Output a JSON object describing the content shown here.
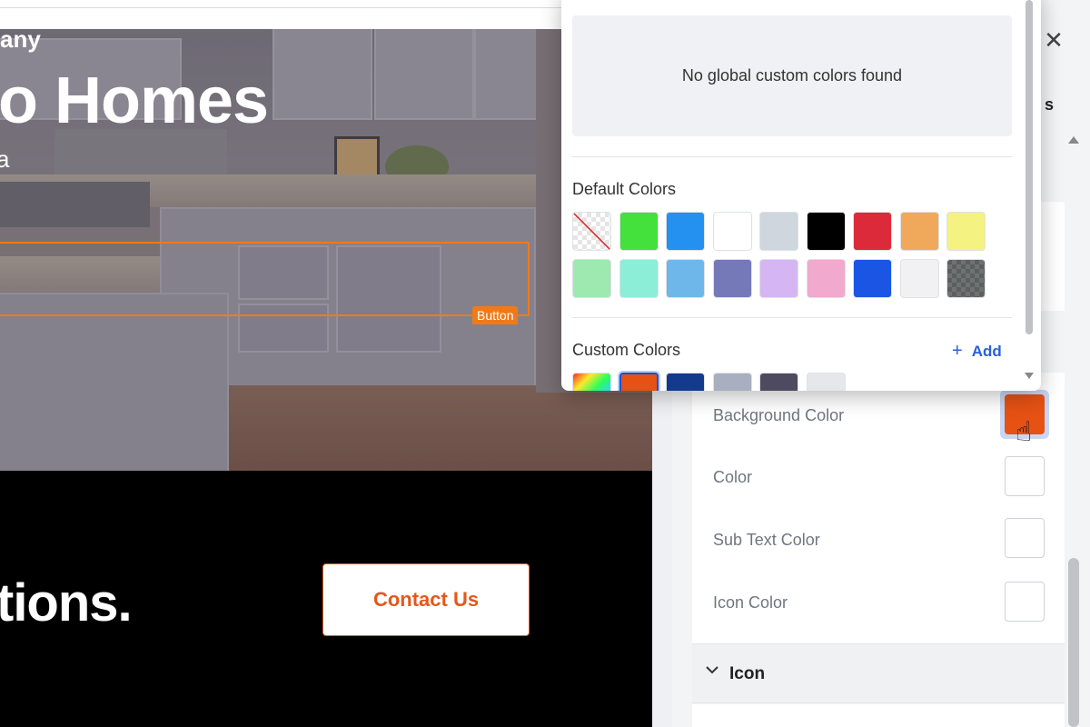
{
  "preview": {
    "hero_company": "any",
    "hero_title": "o Homes",
    "hero_subtitle": "a",
    "selection_tag": "Button",
    "cta_text": "tions.",
    "contact_button": "Contact Us"
  },
  "picker": {
    "global_empty_text": "No global custom colors found",
    "default_heading": "Default Colors",
    "default_colors": [
      "transparent",
      "#44e03c",
      "#2490ef",
      "#ffffff",
      "#cfd6de",
      "#000000",
      "#dd2a3a",
      "#f0a95a",
      "#f4f281",
      "#9de9b0",
      "#8ceed7",
      "#6db7ea",
      "#7579b8",
      "#d5b6f3",
      "#f1a9cd",
      "#1a55e4",
      "#f1f1f3",
      "checker-dark"
    ],
    "custom_heading": "Custom Colors",
    "add_label": "Add",
    "custom_colors": [
      "rainbow",
      "#e65114",
      "#133a8c",
      "#a8afc0",
      "#4e4a60",
      "#e6e7ea"
    ]
  },
  "panel": {
    "tab_partial": "s",
    "properties": [
      {
        "label": "Background Color",
        "color": "#e65114"
      },
      {
        "label": "Color",
        "color": "#ffffff"
      },
      {
        "label": "Sub Text Color",
        "color": "#ffffff"
      },
      {
        "label": "Icon Color",
        "color": "#ffffff"
      }
    ],
    "icon_section": "Icon"
  },
  "icons": {
    "close": "close-icon",
    "add": "plus-icon",
    "chevron": "chevron-down-icon",
    "cursor": "hand-pointer-icon"
  }
}
